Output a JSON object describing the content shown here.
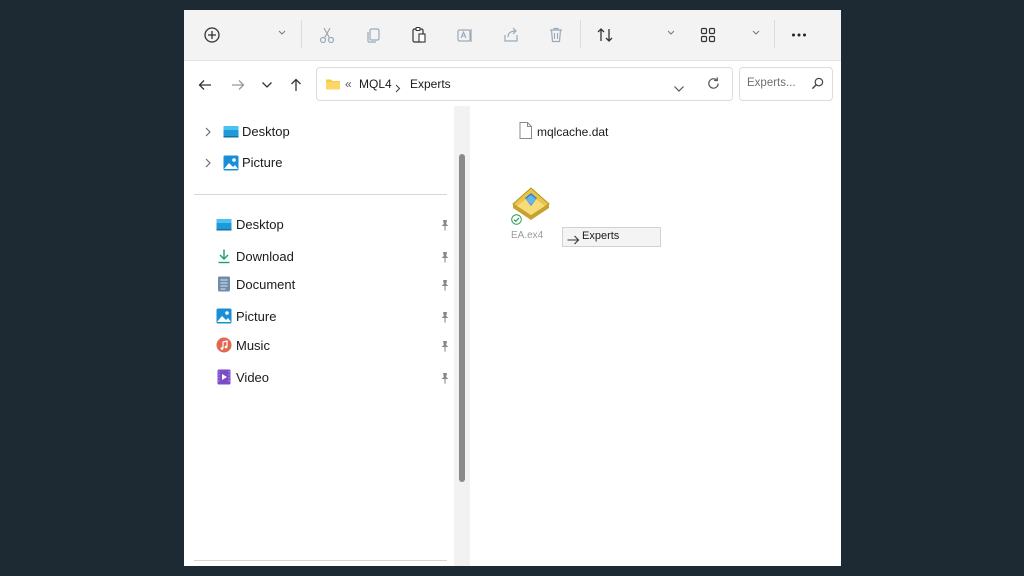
{
  "toolbar": {
    "items": [
      "new-icon",
      "cut-icon",
      "copy-icon",
      "paste-icon",
      "rename-icon",
      "share-icon",
      "delete-icon",
      "sort-icon",
      "view-icon",
      "more-icon"
    ]
  },
  "address": {
    "overflow": "«",
    "crumbs": [
      "MQL4",
      "Experts"
    ]
  },
  "search": {
    "placeholder": "Experts..."
  },
  "sidebar": {
    "tree": [
      {
        "label": "Desktop",
        "icon": "desktop-icon"
      },
      {
        "label": "Picture",
        "icon": "picture-icon"
      }
    ],
    "quick": [
      {
        "label": "Desktop",
        "icon": "desktop-icon"
      },
      {
        "label": "Download",
        "icon": "download-icon"
      },
      {
        "label": "Document",
        "icon": "document-icon"
      },
      {
        "label": "Picture",
        "icon": "picture-icon"
      },
      {
        "label": "Music",
        "icon": "music-icon"
      },
      {
        "label": "Video",
        "icon": "video-icon"
      }
    ]
  },
  "content": {
    "files": [
      {
        "name": "mqlcache.dat",
        "icon": "file-icon"
      }
    ],
    "dragged": {
      "name": "EA.ex4",
      "icon": "ea-file-icon"
    },
    "drop_tip": "Experts"
  },
  "colors": {
    "accent": "#0067c0",
    "folder": "#f7c948"
  }
}
